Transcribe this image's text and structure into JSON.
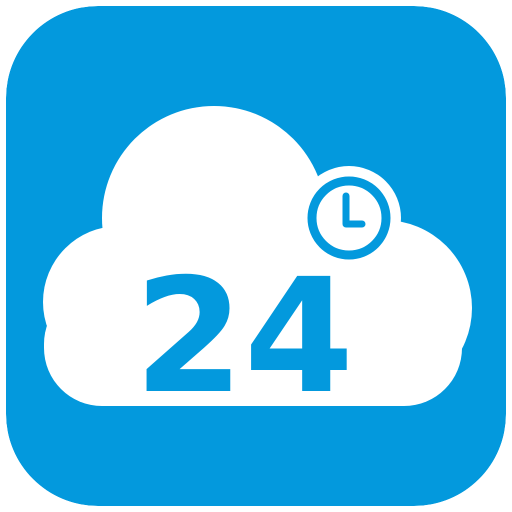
{
  "app_icon": {
    "number": "24",
    "icons": [
      "cloud-icon",
      "clock-icon"
    ]
  },
  "colors": {
    "background_blue": "#0399DD",
    "cloud_white": "#FFFFFF",
    "accent_blue": "#0399DD"
  }
}
